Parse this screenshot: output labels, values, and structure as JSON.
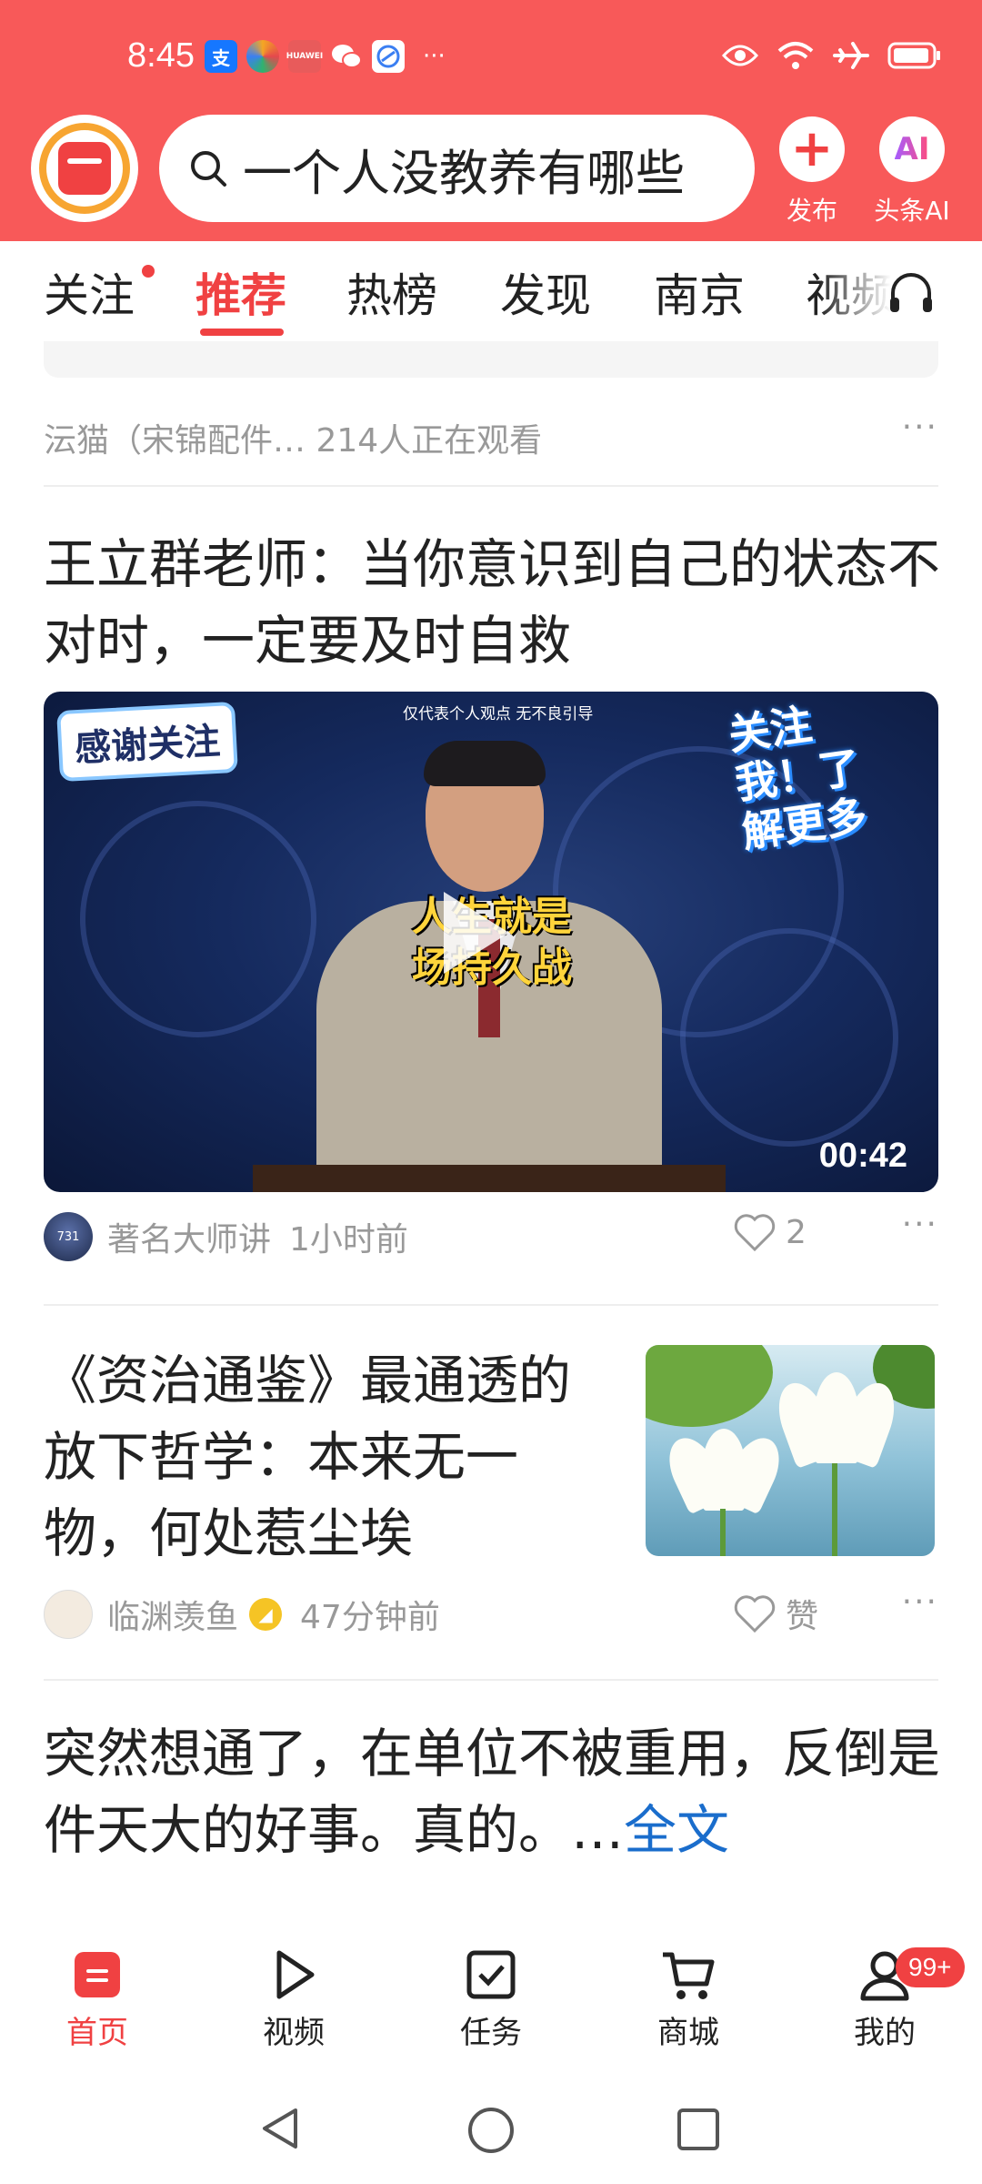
{
  "status_bar": {
    "time": "8:45",
    "apps": [
      {
        "icon": "alipay-icon",
        "glyph": "支",
        "color": "#1677ff"
      },
      {
        "icon": "pinwheel-icon",
        "glyph": "",
        "color": "#f5a623"
      },
      {
        "icon": "huawei-icon",
        "glyph": "",
        "color": "#f85959"
      },
      {
        "icon": "wechat-icon",
        "glyph": "",
        "color": "#ffffff"
      },
      {
        "icon": "browser-icon",
        "glyph": "",
        "color": "#3b7ff2"
      }
    ],
    "more": "···",
    "right_icons": [
      "eye-icon",
      "wifi-icon",
      "airplane-icon",
      "battery-icon"
    ]
  },
  "header": {
    "search_text": "一个人没教养有哪些",
    "publish_label": "发布",
    "ai_label": "头条AI",
    "ai_glyph": "AI",
    "publish_glyph": "+"
  },
  "tabs": [
    {
      "label": "关注"
    },
    {
      "label": "推荐"
    },
    {
      "label": "热榜"
    },
    {
      "label": "发现"
    },
    {
      "label": "南京"
    },
    {
      "label": "视频"
    }
  ],
  "feed": {
    "prev_meta": "沄猫（宋锦配件…  214人正在观看",
    "article1": {
      "title": "王立群老师：当你意识到自己的状态不对时，一定要及时自救",
      "video": {
        "tag_left": "感谢关注",
        "top_note": "仅代表个人观点 无不良引导",
        "tag_right": "关注我！了解更多",
        "caption_line1": "人生就是",
        "caption_line2": "场持久战",
        "duration": "00:42"
      },
      "author": "著名大师讲",
      "time": "1小时前",
      "likes": "2",
      "avatar_text": "731"
    },
    "article2": {
      "title": "《资治通鉴》最通透的放下哲学：本来无一物，何处惹尘埃",
      "author": "临渊羡鱼",
      "time": "47分钟前",
      "like_label": "赞"
    },
    "article3": {
      "text": "突然想通了，在单位不被重用，反倒是件天大的好事。真的。…",
      "link": "全文"
    },
    "more_dots": "···"
  },
  "bottom_nav": {
    "items": [
      {
        "label": "首页",
        "icon": "home-icon"
      },
      {
        "label": "视频",
        "icon": "video-play-icon"
      },
      {
        "label": "任务",
        "icon": "task-check-icon"
      },
      {
        "label": "商城",
        "icon": "cart-icon"
      },
      {
        "label": "我的",
        "icon": "profile-icon"
      }
    ],
    "badge": "99+"
  },
  "colors": {
    "brand_red": "#f85959",
    "accent_red": "#f04142",
    "link_blue": "#1a6dcc"
  }
}
